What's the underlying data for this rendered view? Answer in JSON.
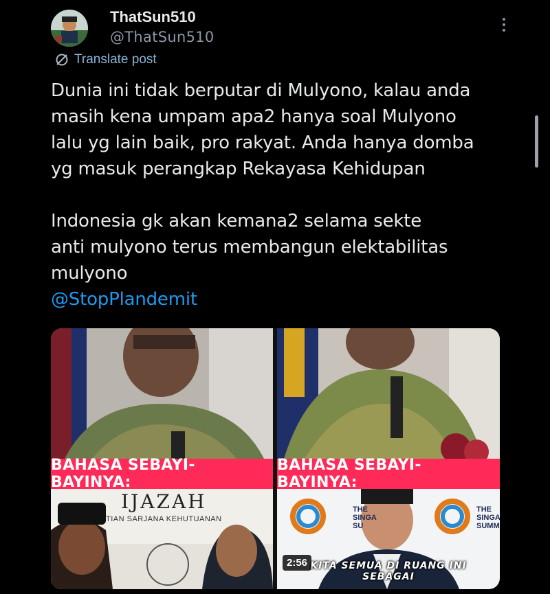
{
  "author": {
    "display_name": "ThatSun510",
    "handle": "@ThatSun510"
  },
  "translate": {
    "label": "Translate post"
  },
  "tweet": {
    "paragraph1": "Dunia ini tidak berputar di Mulyono, kalau anda\nmasih kena umpam apa2 hanya soal Mulyono\nlalu yg lain baik, pro rakyat. Anda hanya domba\nyg masuk perangkap Rekayasa Kehidupan",
    "paragraph2": "Indonesia gk akan kemana2 selama sekte\nanti mulyono terus membangun elektabilitas\nmulyono",
    "mention": "@StopPlandemit"
  },
  "media": {
    "left": {
      "banner": "BAHASA SEBAYI-BAYINYA:",
      "doc_title": "IJAZAH",
      "doc_subtitle": "TIAN SARJANA KEHUTUANAN"
    },
    "right": {
      "banner": "BAHASA SEBAYI-BAYINYA:",
      "duration": "2:56",
      "caption": "KITA SEMUA DI RUANG INI SEBAGAI",
      "summit_label_1": "THE\nSINGA\nSU",
      "summit_label_2": "THE\nSINGAPOR\nSUMM"
    }
  },
  "colors": {
    "background": "#000000",
    "accent": "#1d9bf0",
    "banner": "#ff2a57"
  },
  "icons": {
    "translate": "translate-icon",
    "more": "more-vertical-icon"
  }
}
